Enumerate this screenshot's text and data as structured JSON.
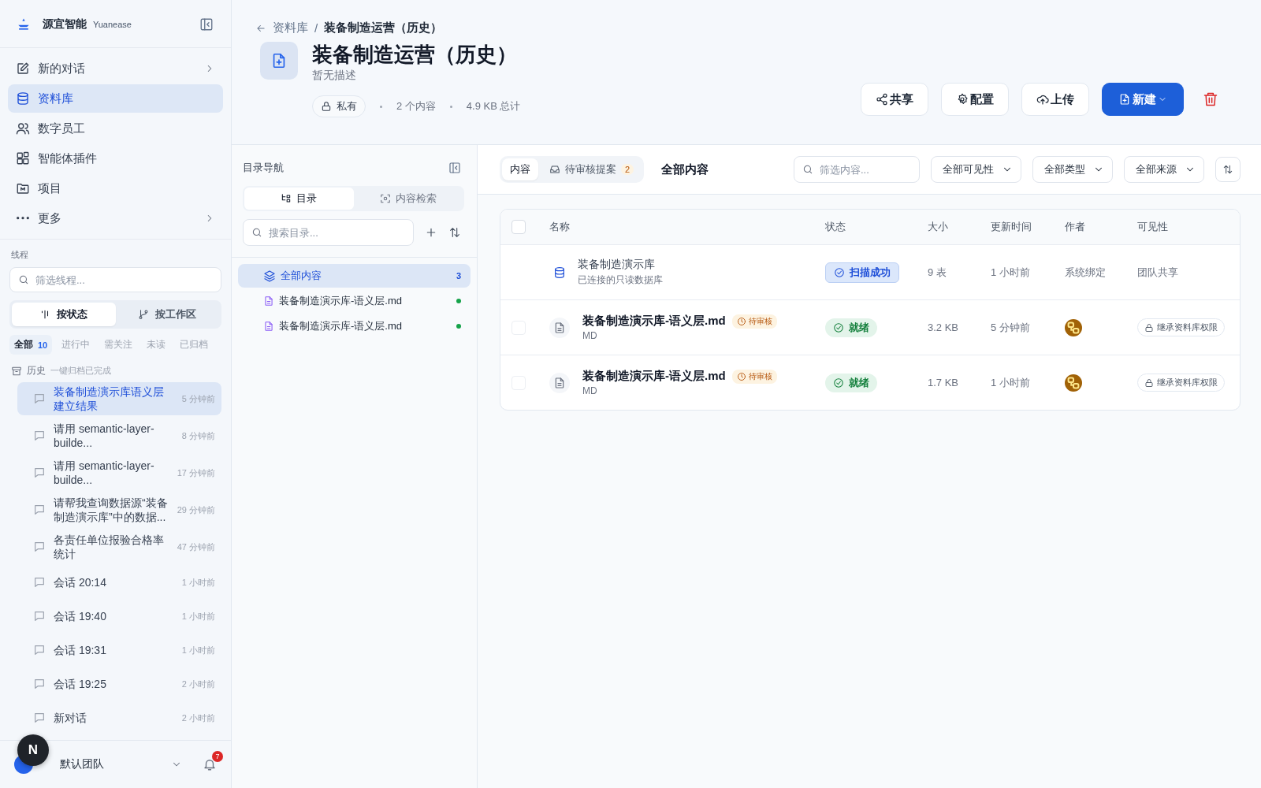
{
  "brand": {
    "name": "源宜智能",
    "sub": "Yuanease"
  },
  "nav": [
    {
      "label": "新的对话",
      "selected": false,
      "chevron": true
    },
    {
      "label": "资料库",
      "selected": true,
      "chevron": false
    },
    {
      "label": "数字员工",
      "selected": false,
      "chevron": false
    },
    {
      "label": "智能体插件",
      "selected": false,
      "chevron": false
    },
    {
      "label": "项目",
      "selected": false,
      "chevron": false
    },
    {
      "label": "更多",
      "selected": false,
      "chevron": true
    }
  ],
  "threads": {
    "title": "线程",
    "filter_placeholder": "筛选线程...",
    "modes": [
      {
        "label": "按状态",
        "selected": true
      },
      {
        "label": "按工作区",
        "selected": false
      }
    ],
    "filters": [
      {
        "label": "全部",
        "count": "10",
        "selected": true
      },
      {
        "label": "进行中",
        "selected": false
      },
      {
        "label": "需关注",
        "selected": false
      },
      {
        "label": "未读",
        "selected": false
      },
      {
        "label": "已归档",
        "selected": false
      }
    ],
    "group": {
      "label": "历史",
      "note": "一键归档已完成"
    },
    "items": [
      {
        "title": "装备制造演示库语义层建立结果",
        "time": "5 分钟前",
        "selected": true
      },
      {
        "title": "请用 semantic-layer-builde...",
        "time": "8 分钟前",
        "selected": false
      },
      {
        "title": "请用 semantic-layer-builde...",
        "time": "17 分钟前",
        "selected": false
      },
      {
        "title": "请帮我查询数据源“装备制造演示库”中的数据...",
        "time": "29 分钟前",
        "selected": false
      },
      {
        "title": "各责任单位报验合格率统计",
        "time": "47 分钟前",
        "selected": false
      },
      {
        "title": "会话 20:14",
        "time": "1 小时前",
        "selected": false
      },
      {
        "title": "会话 19:40",
        "time": "1 小时前",
        "selected": false
      },
      {
        "title": "会话 19:31",
        "time": "1 小时前",
        "selected": false
      },
      {
        "title": "会话 19:25",
        "time": "2 小时前",
        "selected": false
      },
      {
        "title": "新对话",
        "time": "2 小时前",
        "selected": false
      }
    ]
  },
  "footer": {
    "team": "默认团队",
    "floating_avatar": "N",
    "notifications": "7"
  },
  "header": {
    "breadcrumb": {
      "parent": "资料库",
      "separator": "/",
      "current": "装备制造运营（历史）"
    },
    "title": "装备制造运营（历史）",
    "description": "暂无描述",
    "visibility": "私有",
    "meta": [
      "2 个内容",
      "4.9 KB 总计"
    ],
    "actions": [
      {
        "label": "共享",
        "kind": "share"
      },
      {
        "label": "配置",
        "kind": "config"
      },
      {
        "label": "上传",
        "kind": "upload"
      },
      {
        "label": "新建",
        "kind": "new"
      },
      {
        "kind": "delete"
      }
    ]
  },
  "directory": {
    "title": "目录导航",
    "tabs": [
      {
        "label": "目录",
        "selected": true
      },
      {
        "label": "内容检索",
        "selected": false
      }
    ],
    "search_placeholder": "搜索目录...",
    "tree": [
      {
        "label": "全部内容",
        "count": "3",
        "selected": true,
        "children": [
          {
            "label": "装备制造演示库-语义层.md",
            "selected": false,
            "color": "#16a34a"
          },
          {
            "label": "装备制造演示库-语义层.md",
            "selected": false,
            "color": "#16a34a"
          }
        ]
      }
    ]
  },
  "content": {
    "tabs": [
      {
        "label": "内容",
        "selected": true
      },
      {
        "label": "待审核提案",
        "count": "2",
        "selected": false
      }
    ],
    "heading": "全部内容",
    "filter_placeholder": "筛选内容...",
    "selects": [
      "全部可见性",
      "全部类型",
      "全部来源"
    ],
    "table": {
      "all_checked": false,
      "columns": [
        "名称",
        "状态",
        "大小",
        "更新时间",
        "作者",
        "可见性"
      ],
      "rows": [
        {
          "kind": "database",
          "name": "装备制造演示库",
          "subtitle": "已连接的只读数据库",
          "status": {
            "label": "扫描成功",
            "kind": "scanned"
          },
          "size": "9 表",
          "updated": "1 小时前",
          "author": {
            "kind": "text",
            "label": "系统绑定"
          },
          "visibility": {
            "kind": "text",
            "label": "团队共享"
          }
        },
        {
          "kind": "file",
          "checked": false,
          "name": "装备制造演示库-语义层.md",
          "badge": "待审核",
          "subtitle": "MD",
          "status": {
            "label": "就绪",
            "kind": "ready"
          },
          "size": "3.2 KB",
          "updated": "5 分钟前",
          "author": {
            "kind": "avatar"
          },
          "visibility": {
            "kind": "locked",
            "label": "继承资料库权限"
          }
        },
        {
          "kind": "file",
          "checked": false,
          "name": "装备制造演示库-语义层.md",
          "badge": "待审核",
          "subtitle": "MD",
          "status": {
            "label": "就绪",
            "kind": "ready"
          },
          "size": "1.7 KB",
          "updated": "1 小时前",
          "author": {
            "kind": "avatar"
          },
          "visibility": {
            "kind": "locked",
            "label": "继承资料库权限"
          }
        }
      ]
    }
  }
}
